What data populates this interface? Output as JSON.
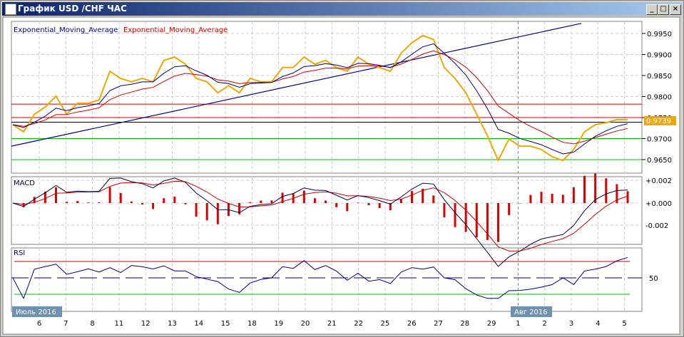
{
  "window": {
    "title": "График USD /CHF  ЧАС",
    "minimize": "_",
    "maximize": "□",
    "close": "×"
  },
  "legend": {
    "ema_fast": "Exponential_Moving_Average",
    "ema_slow": "Exponential_Moving_Average"
  },
  "colors": {
    "price": "#f0a800",
    "ema_fast": "#000080",
    "ema_slow": "#cc0000",
    "macd": "#000040",
    "signal": "#cc0000",
    "hist": "#dd0000",
    "rsi": "#000080",
    "rsi_ob": "#cc33cc",
    "upper": "#cc0000",
    "lower": "#00c000"
  },
  "price_axis": [
    "0.9950",
    "0.9900",
    "0.9850",
    "0.9800",
    "0.9750",
    "0.9700",
    "0.9650"
  ],
  "current_price": "0.9739",
  "macd_panel": {
    "label": "MACD",
    "axis": [
      "+0.002",
      "+0.000",
      "-0.002"
    ]
  },
  "rsi_panel": {
    "label": "RSI",
    "axis": [
      "50"
    ],
    "levels": [
      70,
      50,
      30
    ]
  },
  "dates": [
    "6",
    "7",
    "8",
    "11",
    "12",
    "13",
    "14",
    "15",
    "18",
    "19",
    "20",
    "21",
    "22",
    "25",
    "26",
    "27",
    "28",
    "29",
    "1",
    "2",
    "3",
    "4",
    "5"
  ],
  "month_labels": {
    "july": "Июль 2016",
    "aug": "Авг 2016"
  },
  "chart_data": {
    "type": "line",
    "title": "USD/CHF H1",
    "ylim": [
      0.962,
      0.9975
    ],
    "levels": {
      "red": [
        0.9782,
        0.975
      ],
      "black": [
        0.9739
      ],
      "green": [
        0.97,
        0.965
      ]
    },
    "trendline": [
      0.9682,
      0.9974
    ],
    "close": [
      0.9733,
      0.9716,
      0.9758,
      0.9775,
      0.9801,
      0.9758,
      0.9784,
      0.9784,
      0.9792,
      0.986,
      0.9843,
      0.9835,
      0.9843,
      0.9835,
      0.9886,
      0.9894,
      0.9877,
      0.9843,
      0.9835,
      0.9809,
      0.9826,
      0.9809,
      0.9843,
      0.9835,
      0.9835,
      0.9869,
      0.9869,
      0.9894,
      0.9877,
      0.9886,
      0.9869,
      0.986,
      0.9894,
      0.9877,
      0.9869,
      0.986,
      0.9903,
      0.9928,
      0.9945,
      0.9936,
      0.9869,
      0.9843,
      0.9809,
      0.9758,
      0.9707,
      0.9648,
      0.9699,
      0.9682,
      0.9682,
      0.9674,
      0.9657,
      0.9648,
      0.9674,
      0.9716,
      0.9733,
      0.9738,
      0.9745,
      0.9745
    ]
  }
}
